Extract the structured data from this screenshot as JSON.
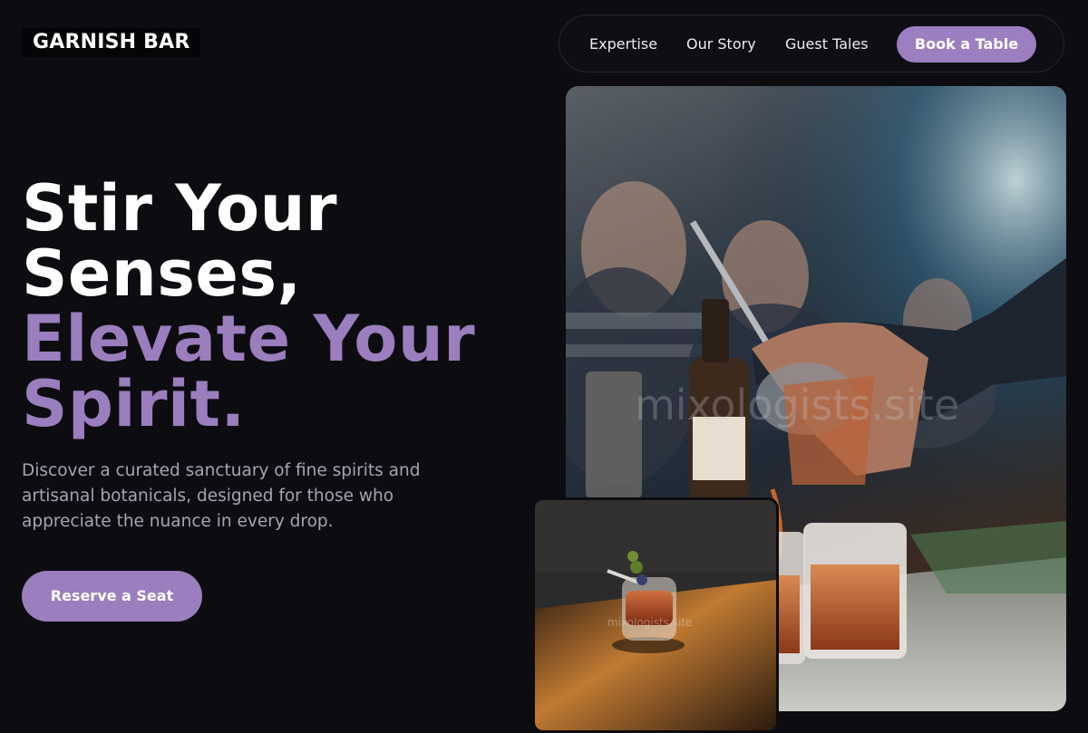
{
  "header": {
    "logo": "GARNISH BAR",
    "nav": [
      "Expertise",
      "Our Story",
      "Guest Tales"
    ],
    "cta": "Book a Table"
  },
  "hero": {
    "title_line1": "Stir Your",
    "title_line2": "Senses,",
    "title_line3": "Elevate Your",
    "title_line4": "Spirit.",
    "description": "Discover a curated sanctuary of fine spirits and artisanal botanicals, designed for those who appreciate the nuance in every drop.",
    "cta": "Reserve a Seat"
  },
  "images": {
    "watermark_main": "mixologists.site",
    "watermark_small": "mixologists.site"
  },
  "colors": {
    "background": "#0d0c11",
    "accent": "#9a7ebd",
    "muted_text": "#a7a3b3"
  }
}
